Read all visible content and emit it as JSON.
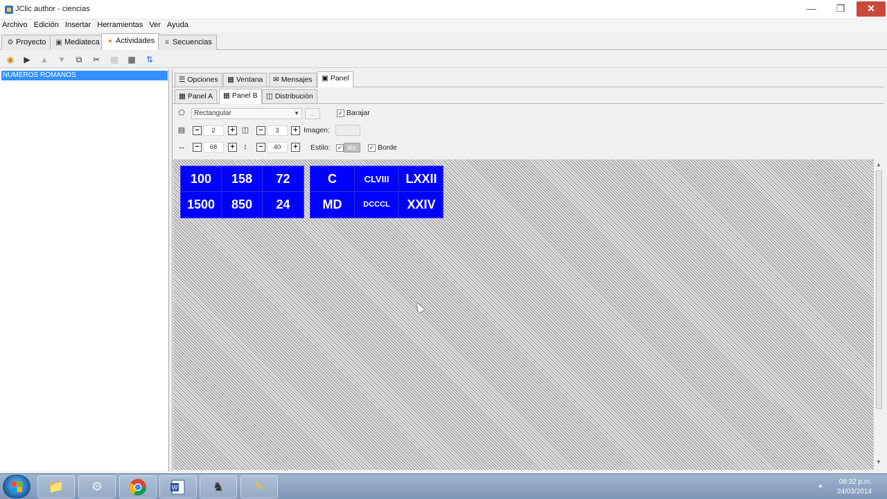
{
  "window": {
    "title": "JClic author - ciencias"
  },
  "menu": [
    "Archivo",
    "Edición",
    "Insertar",
    "Herramientas",
    "Ver",
    "Ayuda"
  ],
  "main_tabs": [
    {
      "label": "Proyecto",
      "icon": "wrench-icon"
    },
    {
      "label": "Mediateca",
      "icon": "media-icon"
    },
    {
      "label": "Actividades",
      "icon": "activities-icon"
    },
    {
      "label": "Secuencias",
      "icon": "sequence-icon"
    }
  ],
  "activity_list": {
    "items": [
      "NUMEROS ROMANOS"
    ]
  },
  "right_tabs": [
    "Opciones",
    "Ventana",
    "Mensajes",
    "Panel"
  ],
  "panel_tabs": [
    "Panel A",
    "Panel B",
    "Distribución"
  ],
  "props": {
    "shape": "Rectangular",
    "more_button": "...",
    "shuffle_label": "Barajar",
    "rows": "2",
    "cols": "3",
    "image_label": "Imagen:",
    "width": "68",
    "height": "40",
    "style_label": "Estilo:",
    "style_sample": "abc",
    "border_label": "Borde"
  },
  "panel_a": {
    "cells": [
      "100",
      "158",
      "72",
      "1500",
      "850",
      "24"
    ]
  },
  "panel_b": {
    "cells": [
      "C",
      "CLVIII",
      "LXXII",
      "MD",
      "DCCCL",
      "XXIV"
    ]
  },
  "taskbar": {
    "time": "08:32 p.m.",
    "date": "24/03/2014",
    "apps": [
      "explorer",
      "settings",
      "chrome",
      "word",
      "jclic",
      "editor"
    ]
  },
  "colors": {
    "cell_bg": "#0000ff",
    "cell_text": "#ffffff",
    "selection": "#3390ff"
  }
}
